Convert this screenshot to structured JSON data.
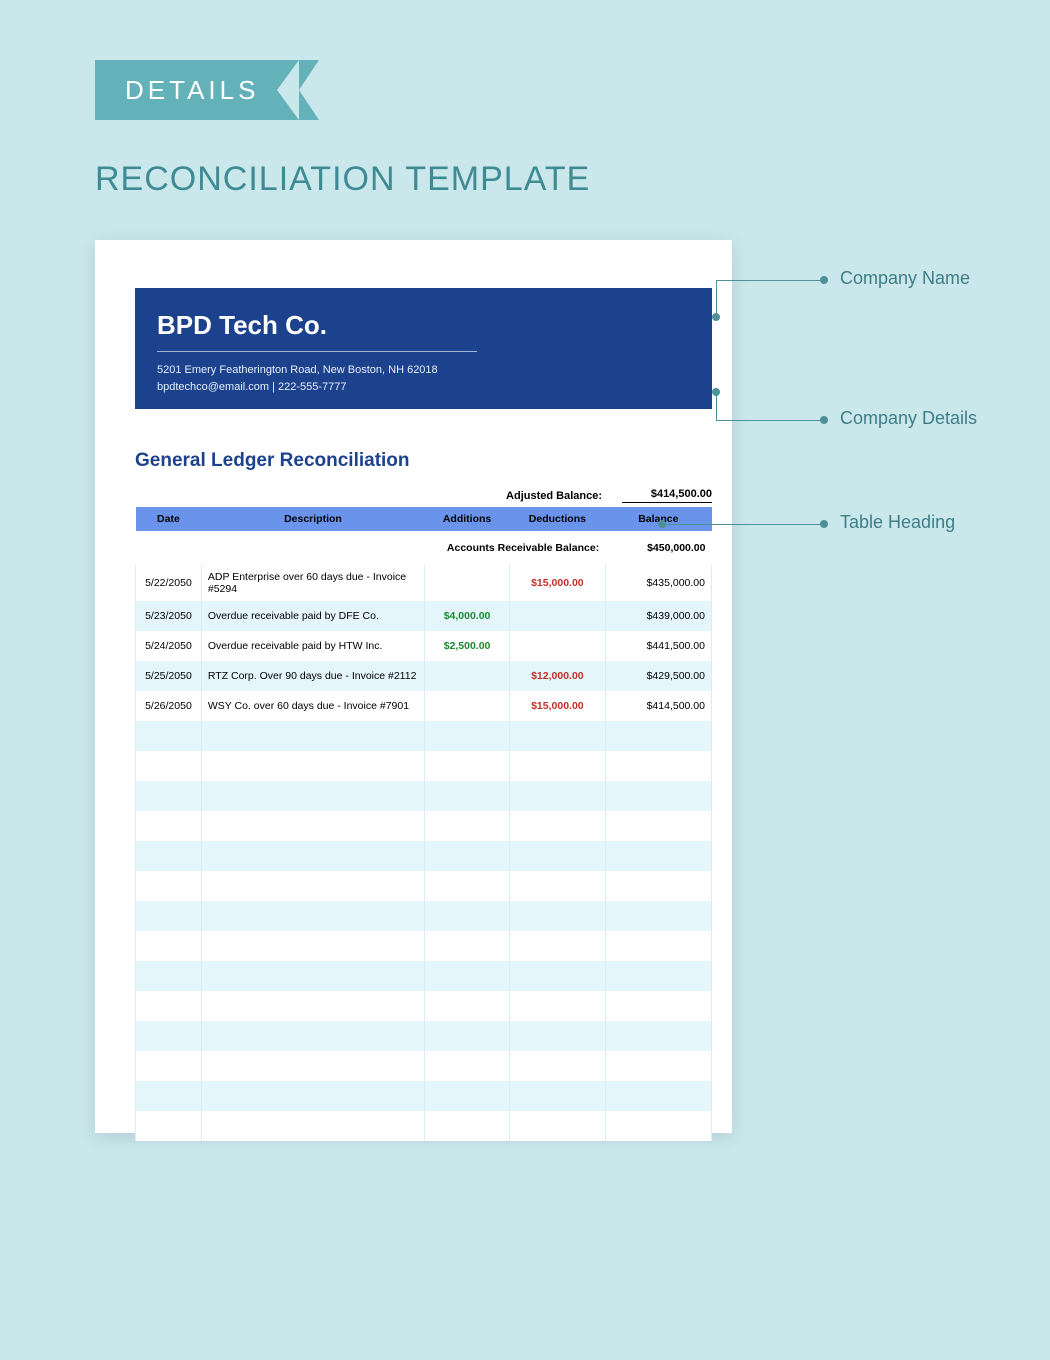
{
  "ribbon": {
    "label": "DETAILS"
  },
  "page": {
    "title": "RECONCILIATION TEMPLATE"
  },
  "company": {
    "name": "BPD Tech Co.",
    "address": "5201 Emery Featherington Road, New Boston, NH 62018",
    "contact": "bpdtechco@email.com | 222-555-7777"
  },
  "ledger": {
    "title": "General Ledger Reconciliation",
    "adjusted_balance_label": "Adjusted Balance:",
    "adjusted_balance": "$414,500.00",
    "headers": {
      "date": "Date",
      "description": "Description",
      "additions": "Additions",
      "deductions": "Deductions",
      "balance": "Balance"
    },
    "ar_label": "Accounts Receivable Balance:",
    "ar_balance": "$450,000.00",
    "rows": [
      {
        "date": "5/22/2050",
        "desc": "ADP Enterprise over 60 days due - Invoice #5294",
        "add": "",
        "ded": "$15,000.00",
        "bal": "$435,000.00"
      },
      {
        "date": "5/23/2050",
        "desc": "Overdue receivable paid by DFE Co.",
        "add": "$4,000.00",
        "ded": "",
        "bal": "$439,000.00"
      },
      {
        "date": "5/24/2050",
        "desc": "Overdue receivable paid by HTW Inc.",
        "add": "$2,500.00",
        "ded": "",
        "bal": "$441,500.00"
      },
      {
        "date": "5/25/2050",
        "desc": "RTZ Corp. Over 90 days due - Invoice #2112",
        "add": "",
        "ded": "$12,000.00",
        "bal": "$429,500.00"
      },
      {
        "date": "5/26/2050",
        "desc": "WSY Co. over 60 days due - Invoice #7901",
        "add": "",
        "ded": "$15,000.00",
        "bal": "$414,500.00"
      }
    ]
  },
  "annotations": {
    "company_name": "Company Name",
    "company_details": "Company Details",
    "table_heading": "Table Heading"
  }
}
